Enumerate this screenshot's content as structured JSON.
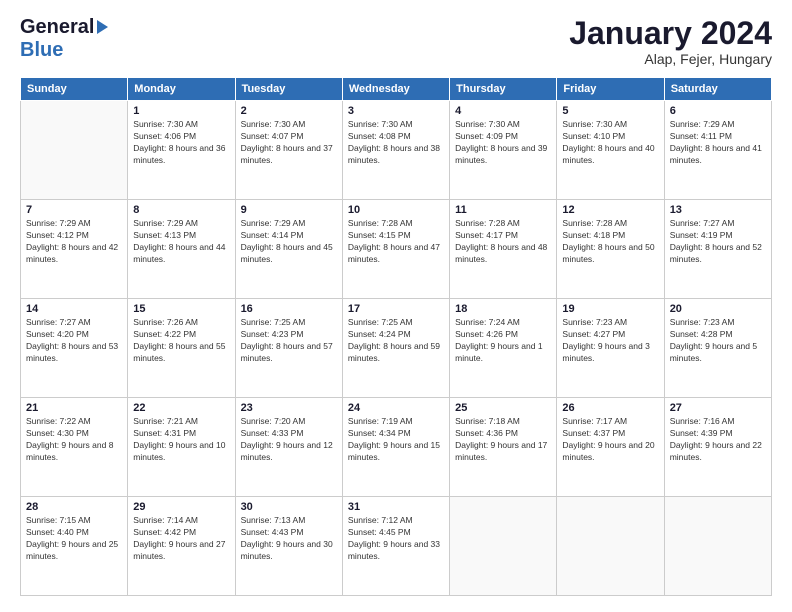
{
  "logo": {
    "line1": "General",
    "line2": "Blue"
  },
  "title": "January 2024",
  "location": "Alap, Fejer, Hungary",
  "days_of_week": [
    "Sunday",
    "Monday",
    "Tuesday",
    "Wednesday",
    "Thursday",
    "Friday",
    "Saturday"
  ],
  "weeks": [
    [
      {
        "day": "",
        "sunrise": "",
        "sunset": "",
        "daylight": ""
      },
      {
        "day": "1",
        "sunrise": "Sunrise: 7:30 AM",
        "sunset": "Sunset: 4:06 PM",
        "daylight": "Daylight: 8 hours and 36 minutes."
      },
      {
        "day": "2",
        "sunrise": "Sunrise: 7:30 AM",
        "sunset": "Sunset: 4:07 PM",
        "daylight": "Daylight: 8 hours and 37 minutes."
      },
      {
        "day": "3",
        "sunrise": "Sunrise: 7:30 AM",
        "sunset": "Sunset: 4:08 PM",
        "daylight": "Daylight: 8 hours and 38 minutes."
      },
      {
        "day": "4",
        "sunrise": "Sunrise: 7:30 AM",
        "sunset": "Sunset: 4:09 PM",
        "daylight": "Daylight: 8 hours and 39 minutes."
      },
      {
        "day": "5",
        "sunrise": "Sunrise: 7:30 AM",
        "sunset": "Sunset: 4:10 PM",
        "daylight": "Daylight: 8 hours and 40 minutes."
      },
      {
        "day": "6",
        "sunrise": "Sunrise: 7:29 AM",
        "sunset": "Sunset: 4:11 PM",
        "daylight": "Daylight: 8 hours and 41 minutes."
      }
    ],
    [
      {
        "day": "7",
        "sunrise": "Sunrise: 7:29 AM",
        "sunset": "Sunset: 4:12 PM",
        "daylight": "Daylight: 8 hours and 42 minutes."
      },
      {
        "day": "8",
        "sunrise": "Sunrise: 7:29 AM",
        "sunset": "Sunset: 4:13 PM",
        "daylight": "Daylight: 8 hours and 44 minutes."
      },
      {
        "day": "9",
        "sunrise": "Sunrise: 7:29 AM",
        "sunset": "Sunset: 4:14 PM",
        "daylight": "Daylight: 8 hours and 45 minutes."
      },
      {
        "day": "10",
        "sunrise": "Sunrise: 7:28 AM",
        "sunset": "Sunset: 4:15 PM",
        "daylight": "Daylight: 8 hours and 47 minutes."
      },
      {
        "day": "11",
        "sunrise": "Sunrise: 7:28 AM",
        "sunset": "Sunset: 4:17 PM",
        "daylight": "Daylight: 8 hours and 48 minutes."
      },
      {
        "day": "12",
        "sunrise": "Sunrise: 7:28 AM",
        "sunset": "Sunset: 4:18 PM",
        "daylight": "Daylight: 8 hours and 50 minutes."
      },
      {
        "day": "13",
        "sunrise": "Sunrise: 7:27 AM",
        "sunset": "Sunset: 4:19 PM",
        "daylight": "Daylight: 8 hours and 52 minutes."
      }
    ],
    [
      {
        "day": "14",
        "sunrise": "Sunrise: 7:27 AM",
        "sunset": "Sunset: 4:20 PM",
        "daylight": "Daylight: 8 hours and 53 minutes."
      },
      {
        "day": "15",
        "sunrise": "Sunrise: 7:26 AM",
        "sunset": "Sunset: 4:22 PM",
        "daylight": "Daylight: 8 hours and 55 minutes."
      },
      {
        "day": "16",
        "sunrise": "Sunrise: 7:25 AM",
        "sunset": "Sunset: 4:23 PM",
        "daylight": "Daylight: 8 hours and 57 minutes."
      },
      {
        "day": "17",
        "sunrise": "Sunrise: 7:25 AM",
        "sunset": "Sunset: 4:24 PM",
        "daylight": "Daylight: 8 hours and 59 minutes."
      },
      {
        "day": "18",
        "sunrise": "Sunrise: 7:24 AM",
        "sunset": "Sunset: 4:26 PM",
        "daylight": "Daylight: 9 hours and 1 minute."
      },
      {
        "day": "19",
        "sunrise": "Sunrise: 7:23 AM",
        "sunset": "Sunset: 4:27 PM",
        "daylight": "Daylight: 9 hours and 3 minutes."
      },
      {
        "day": "20",
        "sunrise": "Sunrise: 7:23 AM",
        "sunset": "Sunset: 4:28 PM",
        "daylight": "Daylight: 9 hours and 5 minutes."
      }
    ],
    [
      {
        "day": "21",
        "sunrise": "Sunrise: 7:22 AM",
        "sunset": "Sunset: 4:30 PM",
        "daylight": "Daylight: 9 hours and 8 minutes."
      },
      {
        "day": "22",
        "sunrise": "Sunrise: 7:21 AM",
        "sunset": "Sunset: 4:31 PM",
        "daylight": "Daylight: 9 hours and 10 minutes."
      },
      {
        "day": "23",
        "sunrise": "Sunrise: 7:20 AM",
        "sunset": "Sunset: 4:33 PM",
        "daylight": "Daylight: 9 hours and 12 minutes."
      },
      {
        "day": "24",
        "sunrise": "Sunrise: 7:19 AM",
        "sunset": "Sunset: 4:34 PM",
        "daylight": "Daylight: 9 hours and 15 minutes."
      },
      {
        "day": "25",
        "sunrise": "Sunrise: 7:18 AM",
        "sunset": "Sunset: 4:36 PM",
        "daylight": "Daylight: 9 hours and 17 minutes."
      },
      {
        "day": "26",
        "sunrise": "Sunrise: 7:17 AM",
        "sunset": "Sunset: 4:37 PM",
        "daylight": "Daylight: 9 hours and 20 minutes."
      },
      {
        "day": "27",
        "sunrise": "Sunrise: 7:16 AM",
        "sunset": "Sunset: 4:39 PM",
        "daylight": "Daylight: 9 hours and 22 minutes."
      }
    ],
    [
      {
        "day": "28",
        "sunrise": "Sunrise: 7:15 AM",
        "sunset": "Sunset: 4:40 PM",
        "daylight": "Daylight: 9 hours and 25 minutes."
      },
      {
        "day": "29",
        "sunrise": "Sunrise: 7:14 AM",
        "sunset": "Sunset: 4:42 PM",
        "daylight": "Daylight: 9 hours and 27 minutes."
      },
      {
        "day": "30",
        "sunrise": "Sunrise: 7:13 AM",
        "sunset": "Sunset: 4:43 PM",
        "daylight": "Daylight: 9 hours and 30 minutes."
      },
      {
        "day": "31",
        "sunrise": "Sunrise: 7:12 AM",
        "sunset": "Sunset: 4:45 PM",
        "daylight": "Daylight: 9 hours and 33 minutes."
      },
      {
        "day": "",
        "sunrise": "",
        "sunset": "",
        "daylight": ""
      },
      {
        "day": "",
        "sunrise": "",
        "sunset": "",
        "daylight": ""
      },
      {
        "day": "",
        "sunrise": "",
        "sunset": "",
        "daylight": ""
      }
    ]
  ]
}
